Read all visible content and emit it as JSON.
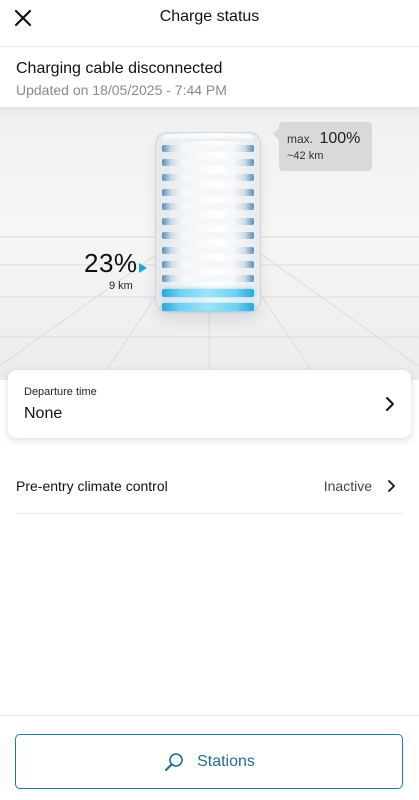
{
  "header": {
    "title": "Charge status",
    "close_icon": "close-icon"
  },
  "status": {
    "title": "Charging cable disconnected",
    "updated": "Updated on 18/05/2025 - 7:44 PM"
  },
  "battery": {
    "max_word": "max.",
    "max_percent": "100%",
    "max_range": "~42 km",
    "current_percent": "23%",
    "current_range": "9 km",
    "total_cells": 12,
    "filled_cells": 2,
    "accent_color": "#1fa6d8"
  },
  "departure": {
    "label": "Departure time",
    "value": "None",
    "icon": "chevron-right-icon"
  },
  "climate": {
    "label": "Pre-entry climate control",
    "value": "Inactive",
    "icon": "chevron-right-icon"
  },
  "footer": {
    "stations_label": "Stations",
    "icon": "search-icon",
    "brand_color": "#1e7da8"
  }
}
